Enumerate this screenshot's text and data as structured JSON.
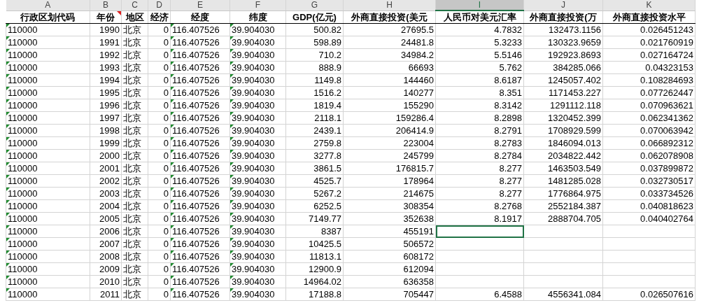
{
  "columns": [
    {
      "letter": "A",
      "header": "行政区划代码",
      "kind": "text_number",
      "comment": false,
      "selected": false
    },
    {
      "letter": "B",
      "header": "年份",
      "kind": "number",
      "comment": true,
      "selected": false
    },
    {
      "letter": "C",
      "header": "地区",
      "kind": "text",
      "comment": false,
      "selected": false
    },
    {
      "letter": "D",
      "header": "经济",
      "kind": "number",
      "comment": false,
      "selected": false
    },
    {
      "letter": "E",
      "header": "经度",
      "kind": "text_number",
      "comment": false,
      "selected": false
    },
    {
      "letter": "F",
      "header": "纬度",
      "kind": "text_number",
      "comment": false,
      "selected": false
    },
    {
      "letter": "G",
      "header": "GDP(亿元)",
      "kind": "number",
      "comment": false,
      "selected": false
    },
    {
      "letter": "H",
      "header": "外商直接投资(美元",
      "kind": "number",
      "comment": false,
      "selected": false
    },
    {
      "letter": "I",
      "header": "人民币对美元汇率",
      "kind": "number",
      "comment": false,
      "selected": true
    },
    {
      "letter": "J",
      "header": "外商直接投资(万",
      "kind": "number",
      "comment": false,
      "selected": false
    },
    {
      "letter": "K",
      "header": "外商直接投资水平",
      "kind": "number",
      "comment": false,
      "selected": false
    }
  ],
  "rows": [
    {
      "selected": false,
      "cells": [
        "110000",
        "1990",
        "北京",
        "0",
        "116.407526",
        "39.904030",
        "500.82",
        "27695.5",
        "4.7832",
        "132473.1156",
        "0.026451243"
      ]
    },
    {
      "selected": false,
      "cells": [
        "110000",
        "1991",
        "北京",
        "0",
        "116.407526",
        "39.904030",
        "598.89",
        "24481.8",
        "5.3233",
        "130323.9659",
        "0.021760919"
      ]
    },
    {
      "selected": false,
      "cells": [
        "110000",
        "1992",
        "北京",
        "0",
        "116.407526",
        "39.904030",
        "710.2",
        "34984.2",
        "5.5146",
        "192923.8693",
        "0.027164724"
      ]
    },
    {
      "selected": false,
      "cells": [
        "110000",
        "1993",
        "北京",
        "0",
        "116.407526",
        "39.904030",
        "888.9",
        "66693",
        "5.762",
        "384285.066",
        "0.04323153"
      ]
    },
    {
      "selected": false,
      "cells": [
        "110000",
        "1994",
        "北京",
        "0",
        "116.407526",
        "39.904030",
        "1149.8",
        "144460",
        "8.6187",
        "1245057.402",
        "0.108284693"
      ]
    },
    {
      "selected": false,
      "cells": [
        "110000",
        "1995",
        "北京",
        "0",
        "116.407526",
        "39.904030",
        "1516.2",
        "140277",
        "8.351",
        "1171453.227",
        "0.077262447"
      ]
    },
    {
      "selected": false,
      "cells": [
        "110000",
        "1996",
        "北京",
        "0",
        "116.407526",
        "39.904030",
        "1819.4",
        "155290",
        "8.3142",
        "1291112.118",
        "0.070963621"
      ]
    },
    {
      "selected": false,
      "cells": [
        "110000",
        "1997",
        "北京",
        "0",
        "116.407526",
        "39.904030",
        "2118.1",
        "159286.4",
        "8.2898",
        "1320452.399",
        "0.062341362"
      ]
    },
    {
      "selected": false,
      "cells": [
        "110000",
        "1998",
        "北京",
        "0",
        "116.407526",
        "39.904030",
        "2439.1",
        "206414.9",
        "8.2791",
        "1708929.599",
        "0.070063942"
      ]
    },
    {
      "selected": false,
      "cells": [
        "110000",
        "1999",
        "北京",
        "0",
        "116.407526",
        "39.904030",
        "2759.8",
        "223004",
        "8.2783",
        "1846094.013",
        "0.066892312"
      ]
    },
    {
      "selected": false,
      "cells": [
        "110000",
        "2000",
        "北京",
        "0",
        "116.407526",
        "39.904030",
        "3277.8",
        "245799",
        "8.2784",
        "2034822.442",
        "0.062078908"
      ]
    },
    {
      "selected": false,
      "cells": [
        "110000",
        "2001",
        "北京",
        "0",
        "116.407526",
        "39.904030",
        "3861.5",
        "176815.7",
        "8.277",
        "1463503.549",
        "0.037899872"
      ]
    },
    {
      "selected": false,
      "cells": [
        "110000",
        "2002",
        "北京",
        "0",
        "116.407526",
        "39.904030",
        "4525.7",
        "178964",
        "8.277",
        "1481285.028",
        "0.032730517"
      ]
    },
    {
      "selected": false,
      "cells": [
        "110000",
        "2003",
        "北京",
        "0",
        "116.407526",
        "39.904030",
        "5267.2",
        "214675",
        "8.277",
        "1776864.975",
        "0.033734526"
      ]
    },
    {
      "selected": false,
      "cells": [
        "110000",
        "2004",
        "北京",
        "0",
        "116.407526",
        "39.904030",
        "6252.5",
        "308354",
        "8.2768",
        "2552184.387",
        "0.040818623"
      ]
    },
    {
      "selected": false,
      "cells": [
        "110000",
        "2005",
        "北京",
        "0",
        "116.407526",
        "39.904030",
        "7149.77",
        "352638",
        "8.1917",
        "2888704.705",
        "0.040402764"
      ]
    },
    {
      "selected": true,
      "cells": [
        "110000",
        "2006",
        "北京",
        "0",
        "116.407526",
        "39.904030",
        "8387",
        "455191"
      ]
    },
    {
      "selected": false,
      "cells": [
        "110000",
        "2007",
        "北京",
        "0",
        "116.407526",
        "39.904030",
        "10425.5",
        "506572"
      ]
    },
    {
      "selected": false,
      "cells": [
        "110000",
        "2008",
        "北京",
        "0",
        "116.407526",
        "39.904030",
        "11813.1",
        "608172"
      ]
    },
    {
      "selected": false,
      "cells": [
        "110000",
        "2009",
        "北京",
        "0",
        "116.407526",
        "39.904030",
        "12900.9",
        "612094"
      ]
    },
    {
      "selected": false,
      "cells": [
        "110000",
        "2010",
        "北京",
        "0",
        "116.407526",
        "39.904030",
        "14964.02",
        "636358"
      ]
    },
    {
      "selected": false,
      "cells": [
        "110000",
        "2011",
        "北京",
        "0",
        "116.407526",
        "39.904030",
        "17188.8",
        "705447",
        "6.4588",
        "4556341.084",
        "0.026507616"
      ]
    }
  ]
}
